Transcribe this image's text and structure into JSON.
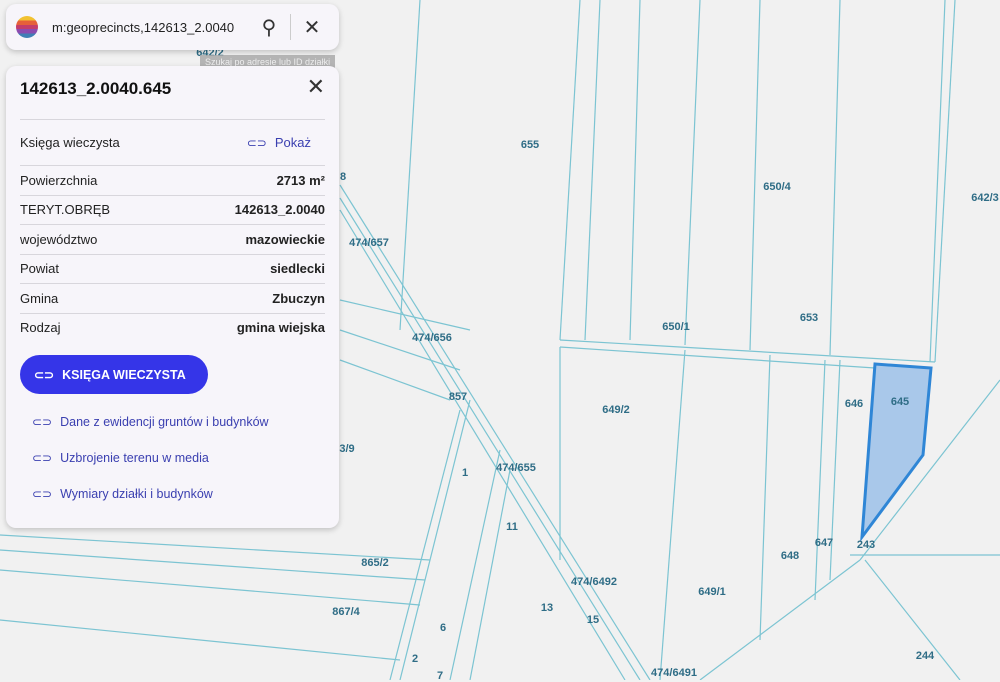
{
  "search": {
    "query": "m:geoprecincts,142613_2.0040",
    "tooltip": "Szukaj po adresie lub ID działki",
    "search_icon": "search-icon",
    "clear_icon": "close-icon"
  },
  "panel": {
    "title": "142613_2.0040.645",
    "kw_label": "Księga wieczysta",
    "kw_link": "Pokaż",
    "rows": [
      {
        "label": "Powierzchnia",
        "value": "2713 m²"
      },
      {
        "label": "TERYT.OBRĘB",
        "value": "142613_2.0040"
      },
      {
        "label": "województwo",
        "value": "mazowieckie"
      },
      {
        "label": "Powiat",
        "value": "siedlecki"
      },
      {
        "label": "Gmina",
        "value": "Zbuczyn"
      },
      {
        "label": "Rodzaj",
        "value": "gmina wiejska"
      }
    ],
    "button": "KSIĘGA WIECZYSTA",
    "links": [
      "Dane z ewidencji gruntów i budynków",
      "Uzbrojenie terenu w media",
      "Wymiary działki i budynków"
    ]
  },
  "map": {
    "labels": [
      "655",
      "650/4",
      "642/3",
      "653",
      "650/1",
      "474/657",
      "474/656",
      "857",
      "649/2",
      "646",
      "645",
      "474/655",
      "1",
      "11",
      "647",
      "243",
      "648",
      "865/2",
      "474/6492",
      "649/1",
      "867/4",
      "13",
      "15",
      "6",
      "2",
      "7",
      "474/6491",
      "244",
      "3/9",
      "642/2",
      "8"
    ],
    "selected_color": "#a9c8ea"
  }
}
